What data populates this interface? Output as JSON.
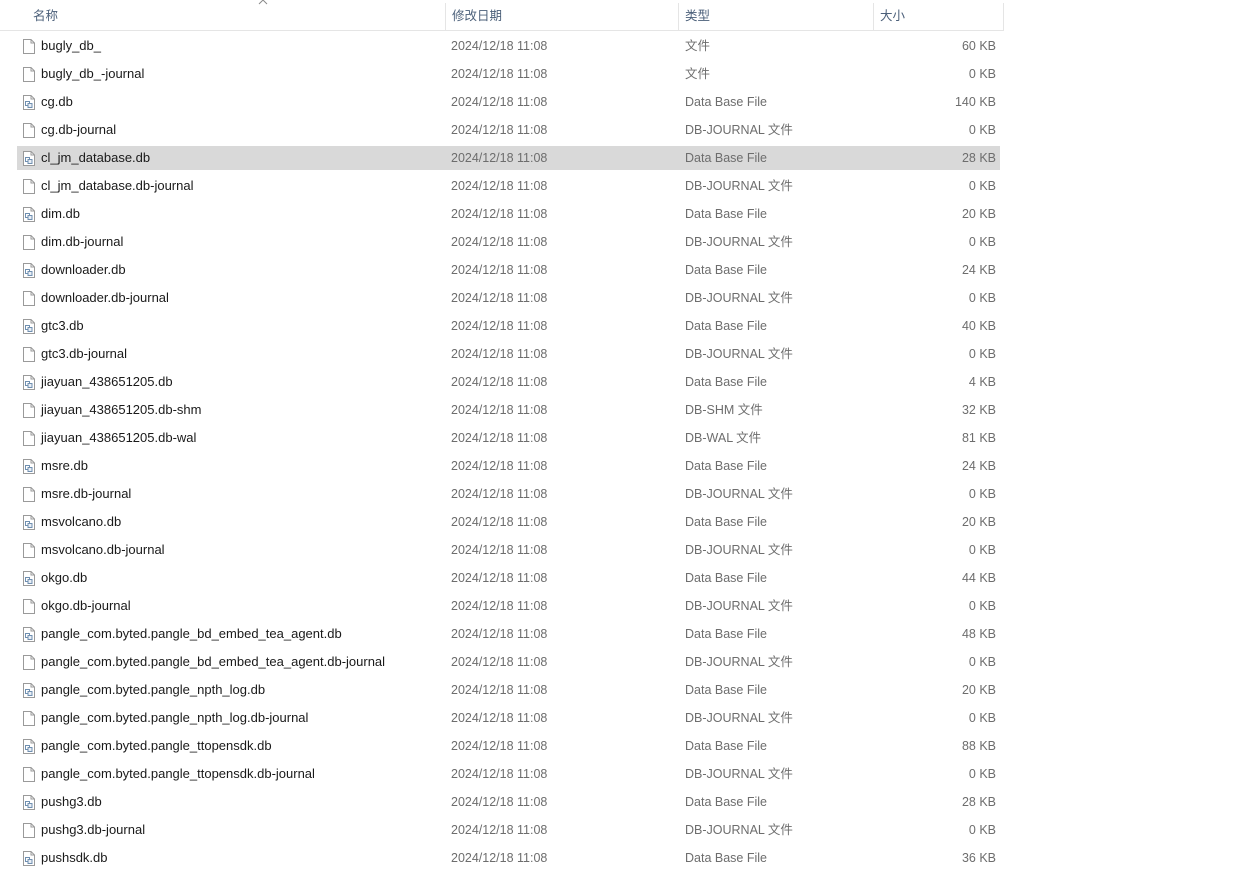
{
  "columns": {
    "name": "名称",
    "date": "修改日期",
    "type": "类型",
    "size": "大小"
  },
  "selected_index": 4,
  "files": [
    {
      "name": "bugly_db_",
      "date": "2024/12/18 11:08",
      "type": "文件",
      "size": "60 KB",
      "icon": "file-icon"
    },
    {
      "name": "bugly_db_-journal",
      "date": "2024/12/18 11:08",
      "type": "文件",
      "size": "0 KB",
      "icon": "file-icon"
    },
    {
      "name": "cg.db",
      "date": "2024/12/18 11:08",
      "type": "Data Base File",
      "size": "140 KB",
      "icon": "database-file-icon"
    },
    {
      "name": "cg.db-journal",
      "date": "2024/12/18 11:08",
      "type": "DB-JOURNAL 文件",
      "size": "0 KB",
      "icon": "file-icon"
    },
    {
      "name": "cl_jm_database.db",
      "date": "2024/12/18 11:08",
      "type": "Data Base File",
      "size": "28 KB",
      "icon": "database-file-icon"
    },
    {
      "name": "cl_jm_database.db-journal",
      "date": "2024/12/18 11:08",
      "type": "DB-JOURNAL 文件",
      "size": "0 KB",
      "icon": "file-icon"
    },
    {
      "name": "dim.db",
      "date": "2024/12/18 11:08",
      "type": "Data Base File",
      "size": "20 KB",
      "icon": "database-file-icon"
    },
    {
      "name": "dim.db-journal",
      "date": "2024/12/18 11:08",
      "type": "DB-JOURNAL 文件",
      "size": "0 KB",
      "icon": "file-icon"
    },
    {
      "name": "downloader.db",
      "date": "2024/12/18 11:08",
      "type": "Data Base File",
      "size": "24 KB",
      "icon": "database-file-icon"
    },
    {
      "name": "downloader.db-journal",
      "date": "2024/12/18 11:08",
      "type": "DB-JOURNAL 文件",
      "size": "0 KB",
      "icon": "file-icon"
    },
    {
      "name": "gtc3.db",
      "date": "2024/12/18 11:08",
      "type": "Data Base File",
      "size": "40 KB",
      "icon": "database-file-icon"
    },
    {
      "name": "gtc3.db-journal",
      "date": "2024/12/18 11:08",
      "type": "DB-JOURNAL 文件",
      "size": "0 KB",
      "icon": "file-icon"
    },
    {
      "name": "jiayuan_438651205.db",
      "date": "2024/12/18 11:08",
      "type": "Data Base File",
      "size": "4 KB",
      "icon": "database-file-icon"
    },
    {
      "name": "jiayuan_438651205.db-shm",
      "date": "2024/12/18 11:08",
      "type": "DB-SHM 文件",
      "size": "32 KB",
      "icon": "file-icon"
    },
    {
      "name": "jiayuan_438651205.db-wal",
      "date": "2024/12/18 11:08",
      "type": "DB-WAL 文件",
      "size": "81 KB",
      "icon": "file-icon"
    },
    {
      "name": "msre.db",
      "date": "2024/12/18 11:08",
      "type": "Data Base File",
      "size": "24 KB",
      "icon": "database-file-icon"
    },
    {
      "name": "msre.db-journal",
      "date": "2024/12/18 11:08",
      "type": "DB-JOURNAL 文件",
      "size": "0 KB",
      "icon": "file-icon"
    },
    {
      "name": "msvolcano.db",
      "date": "2024/12/18 11:08",
      "type": "Data Base File",
      "size": "20 KB",
      "icon": "database-file-icon"
    },
    {
      "name": "msvolcano.db-journal",
      "date": "2024/12/18 11:08",
      "type": "DB-JOURNAL 文件",
      "size": "0 KB",
      "icon": "file-icon"
    },
    {
      "name": "okgo.db",
      "date": "2024/12/18 11:08",
      "type": "Data Base File",
      "size": "44 KB",
      "icon": "database-file-icon"
    },
    {
      "name": "okgo.db-journal",
      "date": "2024/12/18 11:08",
      "type": "DB-JOURNAL 文件",
      "size": "0 KB",
      "icon": "file-icon"
    },
    {
      "name": "pangle_com.byted.pangle_bd_embed_tea_agent.db",
      "date": "2024/12/18 11:08",
      "type": "Data Base File",
      "size": "48 KB",
      "icon": "database-file-icon"
    },
    {
      "name": "pangle_com.byted.pangle_bd_embed_tea_agent.db-journal",
      "date": "2024/12/18 11:08",
      "type": "DB-JOURNAL 文件",
      "size": "0 KB",
      "icon": "file-icon"
    },
    {
      "name": "pangle_com.byted.pangle_npth_log.db",
      "date": "2024/12/18 11:08",
      "type": "Data Base File",
      "size": "20 KB",
      "icon": "database-file-icon"
    },
    {
      "name": "pangle_com.byted.pangle_npth_log.db-journal",
      "date": "2024/12/18 11:08",
      "type": "DB-JOURNAL 文件",
      "size": "0 KB",
      "icon": "file-icon"
    },
    {
      "name": "pangle_com.byted.pangle_ttopensdk.db",
      "date": "2024/12/18 11:08",
      "type": "Data Base File",
      "size": "88 KB",
      "icon": "database-file-icon"
    },
    {
      "name": "pangle_com.byted.pangle_ttopensdk.db-journal",
      "date": "2024/12/18 11:08",
      "type": "DB-JOURNAL 文件",
      "size": "0 KB",
      "icon": "file-icon"
    },
    {
      "name": "pushg3.db",
      "date": "2024/12/18 11:08",
      "type": "Data Base File",
      "size": "28 KB",
      "icon": "database-file-icon"
    },
    {
      "name": "pushg3.db-journal",
      "date": "2024/12/18 11:08",
      "type": "DB-JOURNAL 文件",
      "size": "0 KB",
      "icon": "file-icon"
    },
    {
      "name": "pushsdk.db",
      "date": "2024/12/18 11:08",
      "type": "Data Base File",
      "size": "36 KB",
      "icon": "database-file-icon"
    }
  ]
}
